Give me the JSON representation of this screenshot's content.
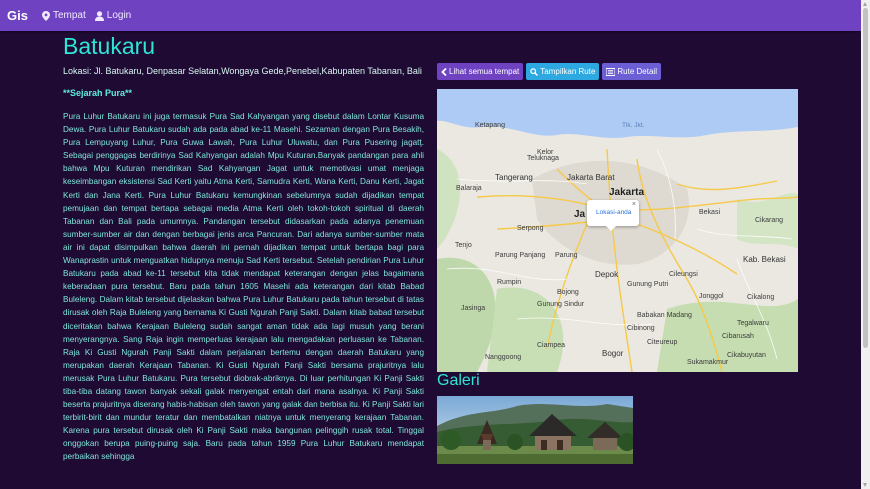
{
  "nav": {
    "brand": "Gis",
    "items": [
      {
        "label": "Tempat",
        "icon": "map-marker-icon"
      },
      {
        "label": "Login",
        "icon": "user-icon"
      }
    ]
  },
  "place": {
    "title": "Batukaru",
    "location": "Lokasi: Jl. Batukaru, Denpasar Selatan,Wongaya Gede,Penebel,Kabupaten Tabanan, Bali",
    "section_title": "**Sejarah Pura**",
    "history": "Pura Luhur Batukaru ini juga termasuk Pura Sad Kahyangan yang disebut dalam Lontar Kusuma Dewa. Pura Luhur Batukaru sudah ada pada abad ke-11 Masehi. Sezaman dengan Pura Besakih, Pura Lempuyang Luhur, Pura Guwa Lawah, Pura Luhur Uluwatu, dan Pura Pusering jagatţ. Sebagai penggagas berdirinya Sad Kahyangan adalah Mpu Kuturan.Banyak pandangan para ahli bahwa Mpu Kuturan mendirikan Sad Kahyangan Jagat untuk memotivasi umat menjaga keseimbangan eksistensi Sad Kerti yaitu Atma Kerti, Samudra Kerti, Wana Kerti, Danu Kerti, Jagat Kerti dan Jana Kerti. Pura Luhur Batukaru kemungkinan sebelumnya sudah dijadikan tempat pemujaan dan tempat bertapa sebagai media Atma Kerti oleh tokoh-tokoh spiritual di daerah Tabanan dan Bali pada umumnya. Pandangan tersebut didasarkan pada adanya penemuan sumber-sumber air dan dengan berbagai jenis arca Pancuran. Dari adanya sumber-sumber mata air ini dapat disimpulkan bahwa daerah ini pernah dijadikan tempat untuk bertapa bagi para Wanaprastin untuk menguatkan hidupnya menuju Sad Kerti tersebut. Setelah pendirian Pura Luhur Batukaru pada abad ke-11 tersebut kita tidak mendapat keterangan dengan jelas bagaimana keberadaan pura tersebut. Baru pada tahun 1605 Masehi ada keterangan dari kitab Babad Buleleng. Dalam kitab tersebut dijelaskan bahwa Pura Luhur Batukaru pada tahun tersebut di tatas dirusak oleh Raja Buleleng yang bernama Ki Gusti Ngurah Panji Sakti. Dalam kitab babad tersebut diceritakan bahwa Kerajaan Buleleng sudah sangat aman tidak ada lagi musuh yang berani menyerangnya. Sang Raja ingin memperluas kerajaan lalu mengadakan perluasan ke Tabanan. Raja Ki Gusti Ngurah Panji Sakti dalam perjalanan bertemu dengan daerah Batukaru yang merupakan daerah Kerajaan Tabanan. Ki Gusti Ngurah Panji Sakti bersama prajuritnya lalu merusak Pura Luhur Batukaru. Pura tersebut diobrak-abriknya. Di luar perhitungan Ki Panji Sakti tiba-tiba datang tawon banyak sekali galak menyengat entah dari mana asalnya. Ki Panji Sakti beserta prajuritnya diserang habis-habisan oleh tawon yang galak dan berbisa itu. Ki Panji Sakti lari terbirit-birit dan mundur teratur dan membatalkan niatnya untuk menyerang kerajaan Tabanan. Karena pura tersebut dirusak oleh Ki Panji Sakti maka bangunan pelinggih rusak total. Tinggal onggokan berupa puing-puing saja. Baru pada tahun 1959 Pura Luhur Batukaru mendapat perbaikan sehingga"
  },
  "actions": {
    "all_places": "Lihat semua tempat",
    "show_route": "Tampilkan Rute",
    "route_detail": "Rute Detail"
  },
  "map": {
    "info_label": "Lokasi-anda",
    "info_close": "×",
    "labels": {
      "tk_jkt": "Tlk. Jkt.",
      "ketapang": "Ketapang",
      "kelor": "Kelor",
      "teluknaga": "Teluknaga",
      "tangerang": "Tangerang",
      "jakarta_barat": "Jakarta Barat",
      "jakarta": "Jakarta",
      "balaraja": "Balaraja",
      "jakarta_partial": "Ja",
      "tenjo": "Tenjo",
      "parung_panjang": "Parung Panjang",
      "parung": "Parung",
      "depok": "Depok",
      "gunung_putri": "Gunung Putri",
      "cileungsi": "Cileungsi",
      "kab_bekasi": "Kab. Bekasi",
      "jonggol": "Jonggol",
      "jasinga": "Jasinga",
      "tegalwaru": "Tegalwaru",
      "babakan_madang": "Babakan Madang",
      "cibarusah": "Cibarusah",
      "ciampea": "Ciampea",
      "nanggoong": "Nanggoong",
      "bogor": "Bogor",
      "citeureup": "Citeureup",
      "cikalong": "Cikalong",
      "cikabuyutan": "Cikabuyutan",
      "bekasi": "Bekasi",
      "cikarang": "Cikarang",
      "serpong": "Serpong",
      "rumpin": "Rumpin",
      "bojong": "Bojong",
      "sukamakmur": "Sukamakmur",
      "gunung_sindur": "Gunung Sindur",
      "cibinong": "Cibinong"
    }
  },
  "gallery": {
    "title": "Galeri"
  },
  "colors": {
    "navbar": "#6f42c1",
    "background": "#1f0a33",
    "title": "#2ee6d6",
    "text": "#7fe9db"
  }
}
